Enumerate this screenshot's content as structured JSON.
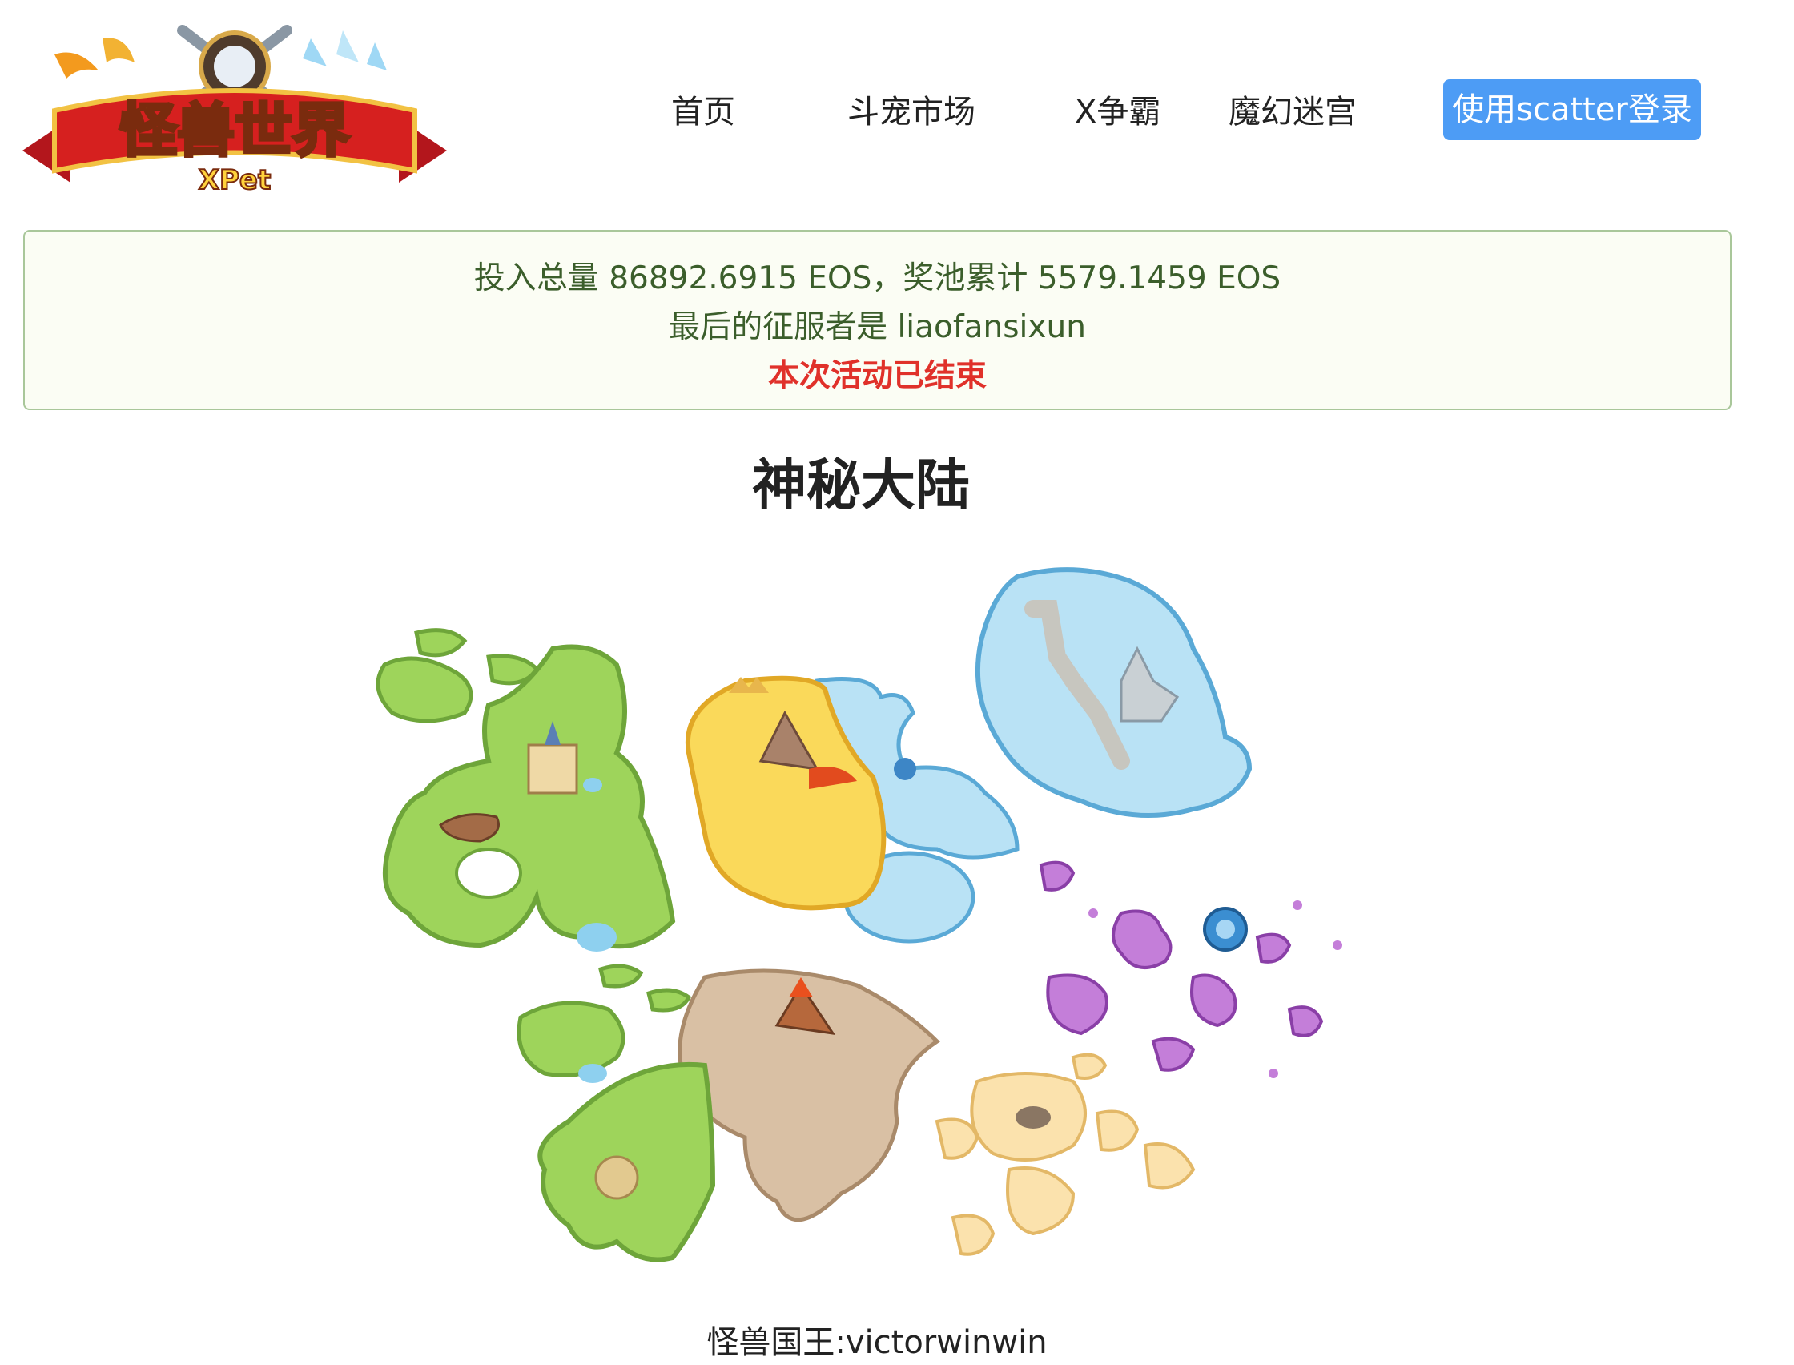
{
  "logo": {
    "title": "怪兽世界",
    "subtitle": "XPet"
  },
  "nav": {
    "items": [
      {
        "label": "首页"
      },
      {
        "label": "斗宠市场"
      },
      {
        "label": "X争霸"
      },
      {
        "label": "魔幻迷宫"
      }
    ],
    "login_label": "使用scatter登录",
    "login_color": "#4d9cf5"
  },
  "info": {
    "summary": "投入总量 86892.6915 EOS，奖池累计 5579.1459 EOS",
    "conqueror": "最后的征服者是 liaofansixun",
    "status": "本次活动已结束",
    "status_color": "#e0312a"
  },
  "title": "神秘大陆",
  "map": {
    "regions": [
      {
        "name": "grassland",
        "color": "#9ed45b"
      },
      {
        "name": "desert",
        "color": "#fad95a"
      },
      {
        "name": "ice-sea",
        "color": "#aadcf4"
      },
      {
        "name": "volcano-plain",
        "color": "#d9c0a4"
      },
      {
        "name": "magic-islands",
        "color": "#c47ed9"
      },
      {
        "name": "sand-isles",
        "color": "#fbe2ad"
      }
    ]
  },
  "king": "怪兽国王:victorwinwin"
}
